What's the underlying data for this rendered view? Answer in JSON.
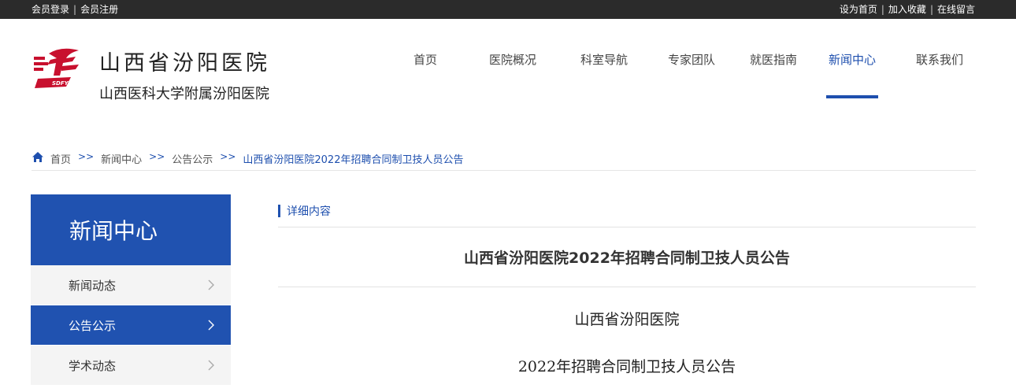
{
  "topbar": {
    "login": "会员登录",
    "register": "会员注册",
    "set_home": "设为首页",
    "add_favorite": "加入收藏",
    "message": "在线留言",
    "separator": "|"
  },
  "header": {
    "title": "山西省汾阳医院",
    "subtitle": "山西医科大学附属汾阳医院",
    "logo_icon": "hospital-logo-icon"
  },
  "nav": {
    "items": [
      {
        "label": "首页"
      },
      {
        "label": "医院概况"
      },
      {
        "label": "科室导航"
      },
      {
        "label": "专家团队"
      },
      {
        "label": "就医指南"
      },
      {
        "label": "新闻中心",
        "active": true
      },
      {
        "label": "联系我们"
      }
    ]
  },
  "breadcrumb": {
    "home_icon": "home-icon",
    "separator": ">>",
    "items": [
      "首页",
      "新闻中心",
      "公告公示"
    ],
    "current": "山西省汾阳医院2022年招聘合同制卫技人员公告"
  },
  "sidebar": {
    "title": "新闻中心",
    "items": [
      {
        "label": "新闻动态"
      },
      {
        "label": "公告公示",
        "active": true
      },
      {
        "label": "学术动态"
      }
    ]
  },
  "content": {
    "section_label": "详细内容",
    "title": "山西省汾阳医院2022年招聘合同制卫技人员公告",
    "paragraphs": [
      "山西省汾阳医院",
      "2022年招聘合同制卫技人员公告"
    ]
  },
  "colors": {
    "accent": "#1e4fae",
    "sidebar_bg": "#2052b0",
    "topbar_bg": "#2b2b2b",
    "logo_red": "#c8102e"
  }
}
